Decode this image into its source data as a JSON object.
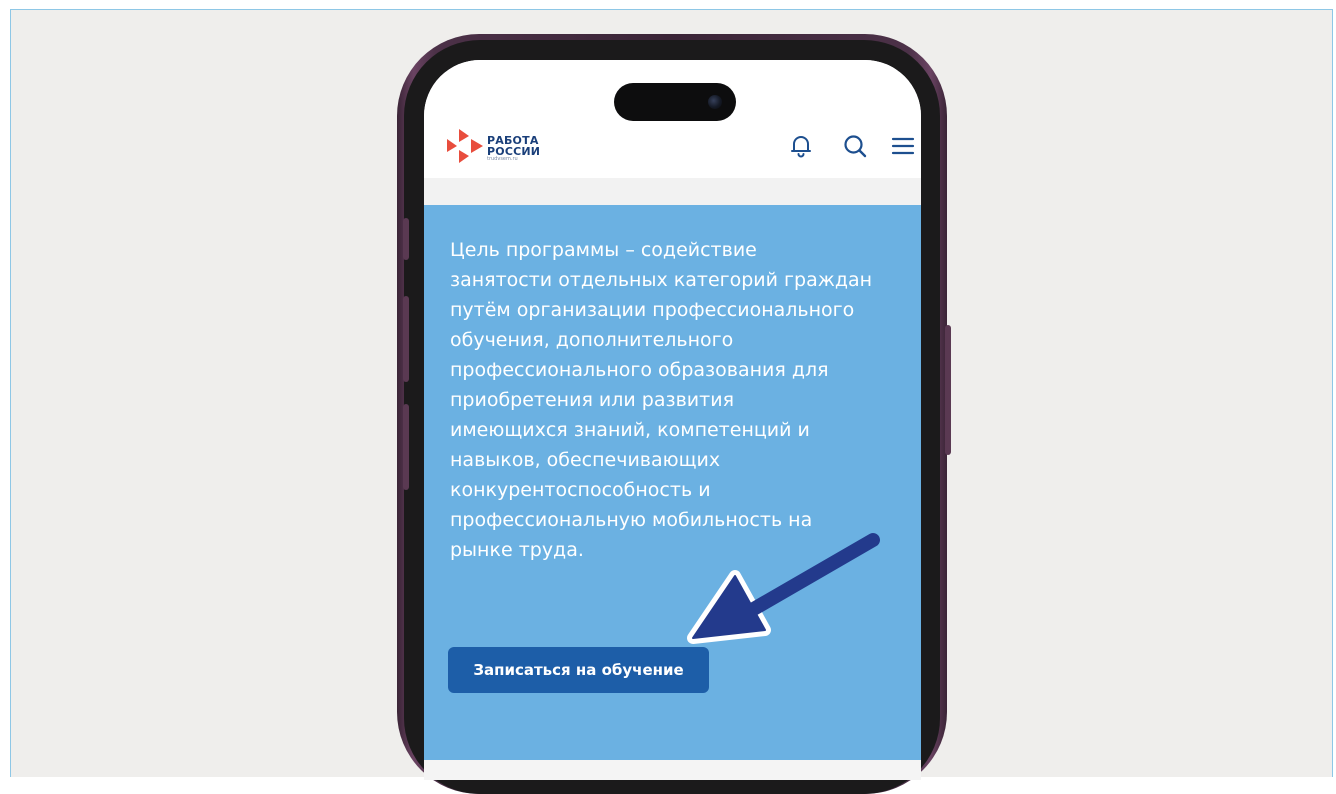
{
  "site": {
    "logo_line1": "РАБОТА",
    "logo_line2": "РОССИИ",
    "logo_domain": "trudvsem.ru"
  },
  "header_icons": [
    "bell-icon",
    "search-icon",
    "menu-icon"
  ],
  "content": {
    "description": "Цель программы – содействие\nзанятости отдельных категорий граждан\nпутём организации профессионального\nобучения, дополнительного\nпрофессионального образования для\nприобретения или развития\nимеющихся знаний, компетенций и\nнавыков, обеспечивающих\nконкурентоспособность и\nпрофессиональную мобильность на\nрынке труда.",
    "enroll_button": "Записаться на обучение"
  },
  "colors": {
    "panel": "#6bb1e2",
    "button": "#1d5ea8",
    "brand_blue": "#1a3f7a",
    "brand_red": "#e84d3d",
    "arrow": "#233a8c"
  }
}
